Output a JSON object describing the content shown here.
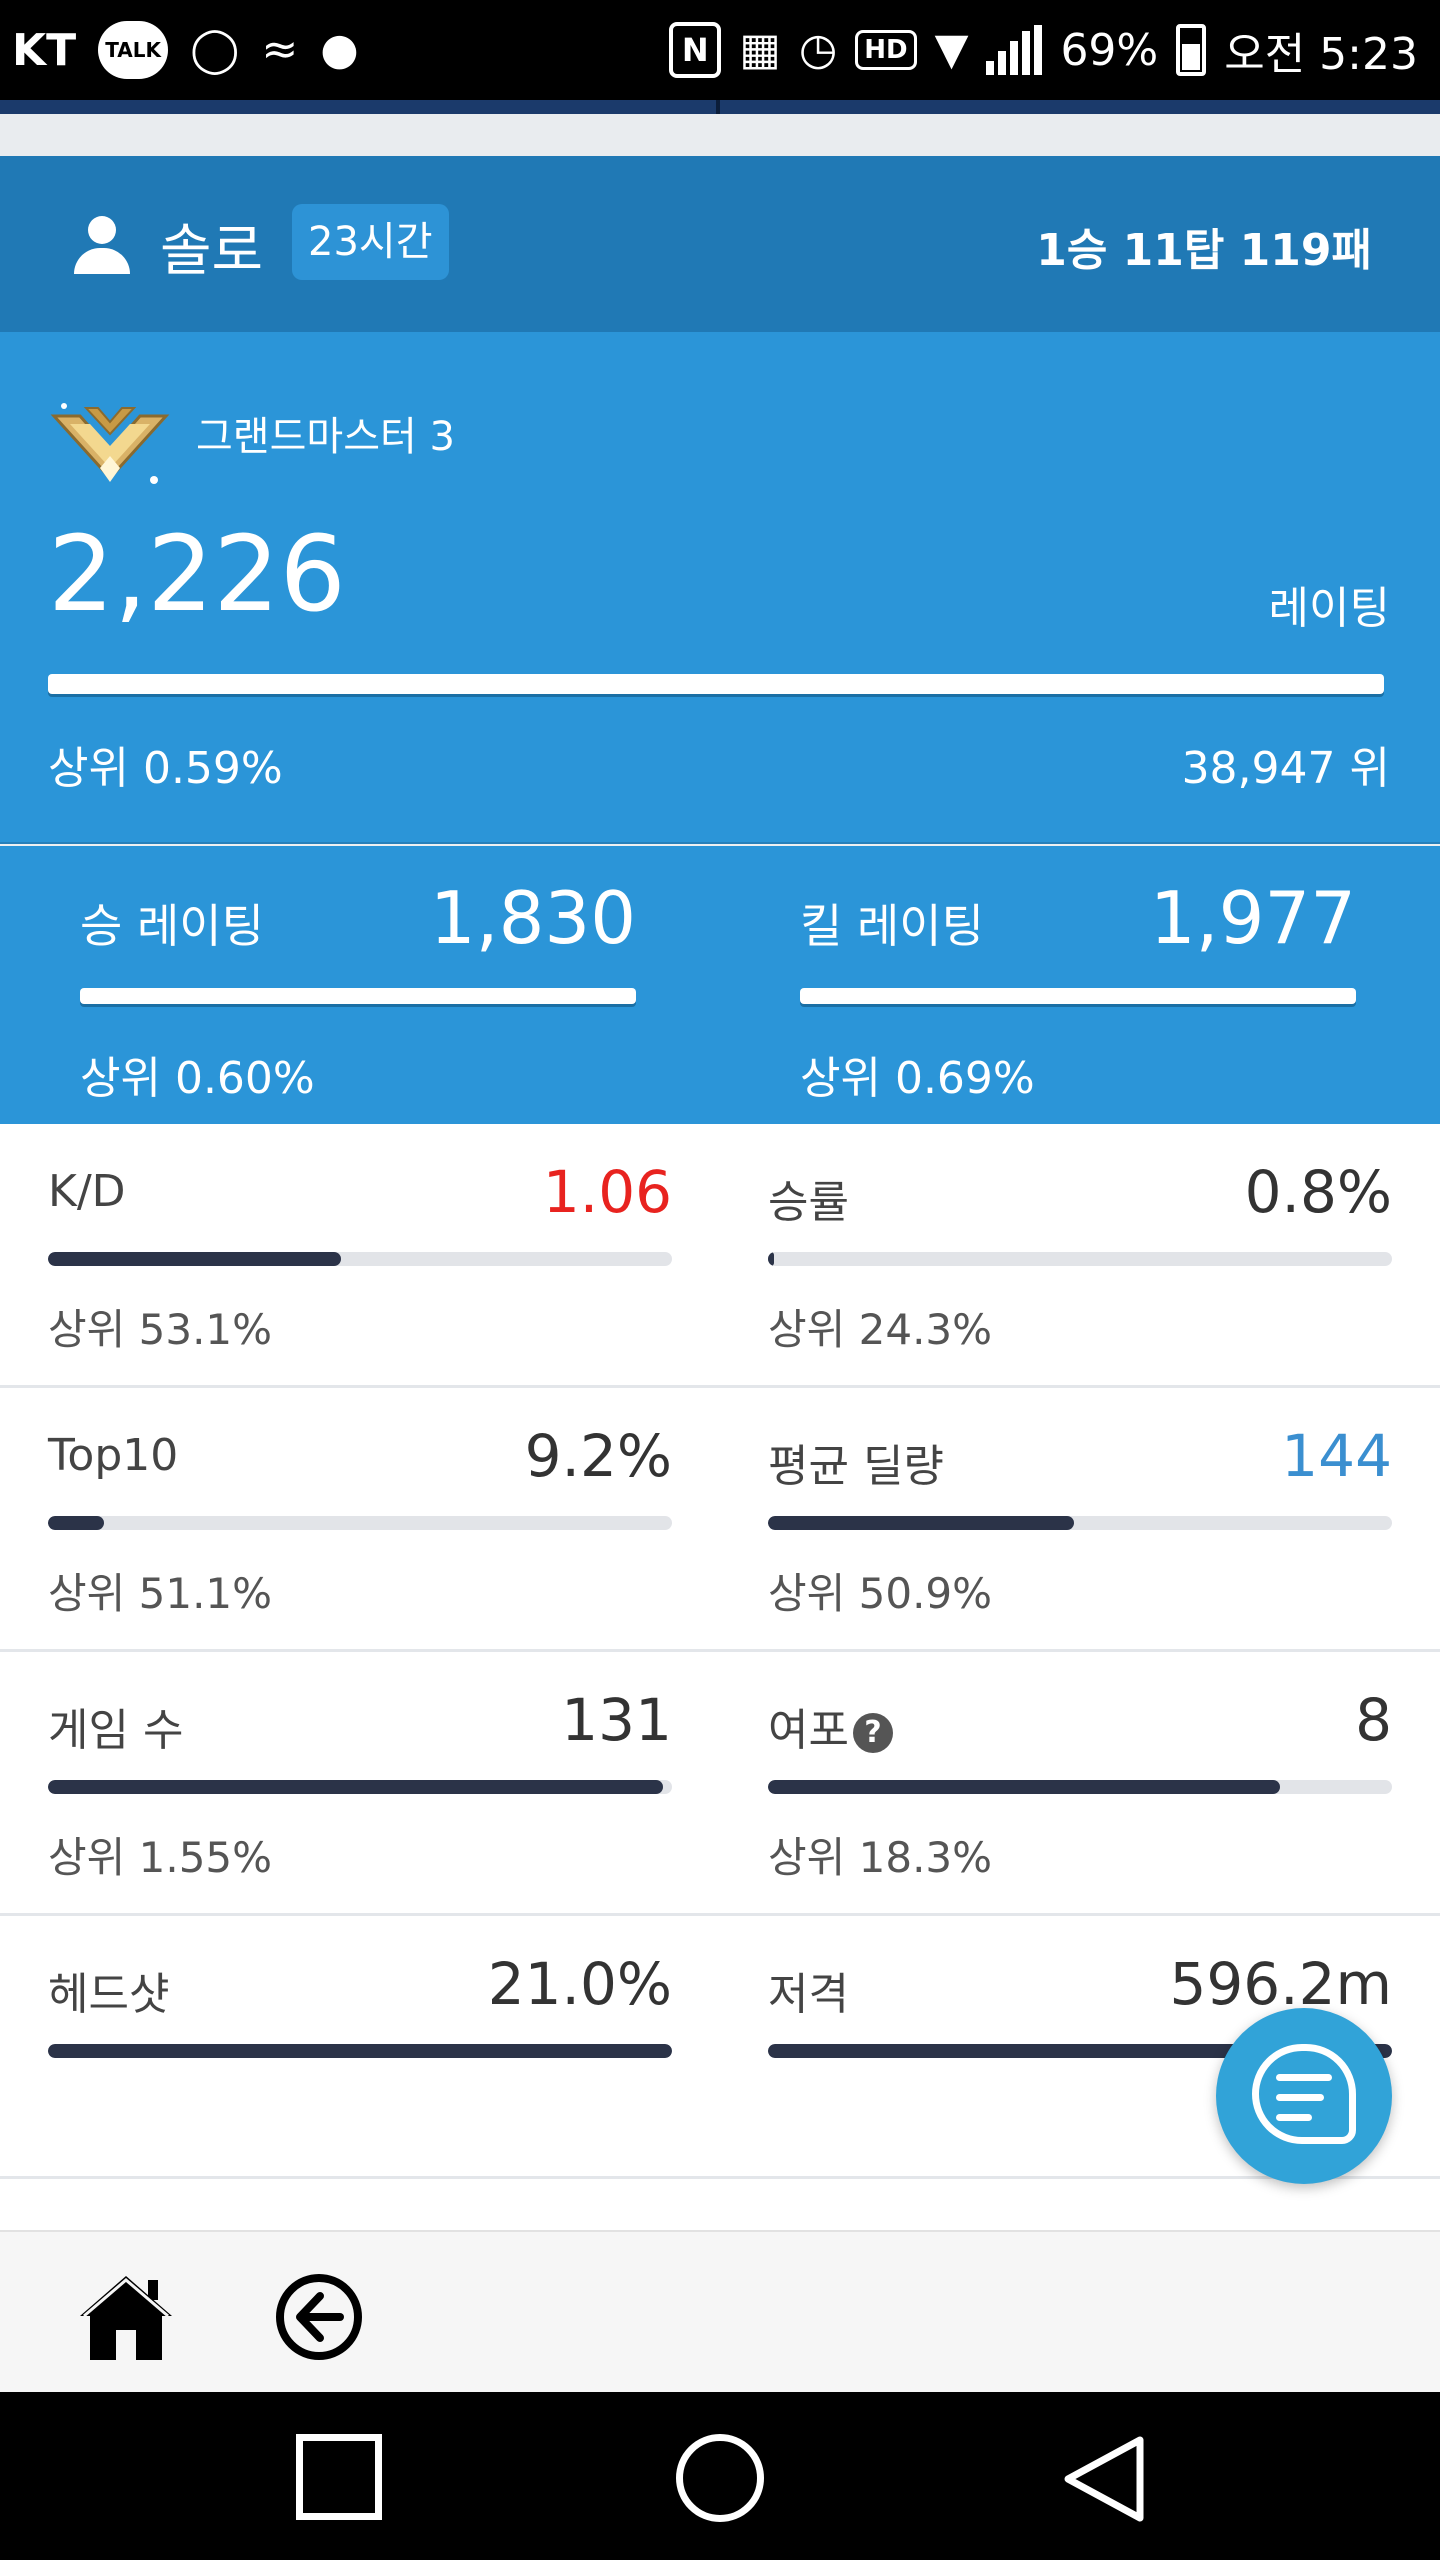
{
  "status_bar": {
    "carrier": "KT",
    "talk_badge": "TALK",
    "nfc": "N",
    "hd_badge": "HD",
    "battery": "69%",
    "time": "오전 5:23"
  },
  "solo_header": {
    "label": "솔로",
    "time_badge": "23시간",
    "record": "1승 11탑 119패"
  },
  "rating": {
    "rank_name": "그랜드마스터 3",
    "value": "2,226",
    "label": "레이팅",
    "top_percent": "상위 0.59%",
    "rank": "38,947 위",
    "bar_fill": 1.0
  },
  "sub_ratings": [
    {
      "label": "승 레이팅",
      "value": "1,830",
      "top": "상위 0.60%",
      "bar_fill": 1.0
    },
    {
      "label": "킬 레이팅",
      "value": "1,977",
      "top": "상위 0.69%",
      "bar_fill": 1.0
    }
  ],
  "stats": [
    {
      "label": "K/D",
      "value": "1.06",
      "value_color": "#e8231f",
      "top": "상위 53.1%",
      "fill": 0.47
    },
    {
      "label": "승률",
      "value": "0.8%",
      "value_color": "#333333",
      "top": "상위 24.3%",
      "fill": 0.008
    },
    {
      "label": "Top10",
      "value": "9.2%",
      "value_color": "#333333",
      "top": "상위 51.1%",
      "fill": 0.09
    },
    {
      "label": "평균 딜량",
      "value": "144",
      "value_color": "#3b8fd0",
      "top": "상위 50.9%",
      "fill": 0.49
    },
    {
      "label": "게임 수",
      "value": "131",
      "value_color": "#333333",
      "top": "상위 1.55%",
      "fill": 0.985
    },
    {
      "label": "여포",
      "value": "8",
      "value_color": "#333333",
      "top": "상위 18.3%",
      "fill": 0.82,
      "help_icon": "question-circle-icon"
    },
    {
      "label": "헤드샷",
      "value": "21.0%",
      "value_color": "#333333",
      "top": "",
      "fill": 1.0
    },
    {
      "label": "저격",
      "value": "596.2m",
      "value_color": "#333333",
      "top": "",
      "fill": 1.0
    }
  ],
  "colors": {
    "header_blue": "#2079b5",
    "rating_blue": "#2b95d8",
    "bar_dark": "#2b3348",
    "fab_blue": "#31a3d8"
  },
  "icons": {
    "fab": "chat-icon",
    "home": "home-icon",
    "back": "back-arrow-icon"
  }
}
